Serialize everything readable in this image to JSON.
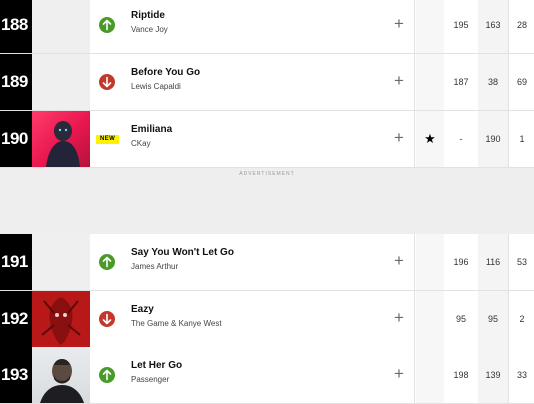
{
  "rows": [
    {
      "rank": "188",
      "title": "Riptide",
      "artist": "Vance Joy",
      "movement": "up",
      "last": "195",
      "peak": "163",
      "weeks": "28",
      "star": ""
    },
    {
      "rank": "189",
      "title": "Before You Go",
      "artist": "Lewis Capaldi",
      "movement": "down",
      "last": "187",
      "peak": "38",
      "weeks": "69",
      "star": ""
    },
    {
      "rank": "190",
      "title": "Emiliana",
      "artist": "CKay",
      "movement": "new",
      "badge": "NEW",
      "last": "-",
      "peak": "190",
      "weeks": "1",
      "star": "★"
    },
    {
      "rank": "191",
      "title": "Say You Won't Let Go",
      "artist": "James Arthur",
      "movement": "up",
      "last": "196",
      "peak": "116",
      "weeks": "53",
      "star": ""
    },
    {
      "rank": "192",
      "title": "Eazy",
      "artist": "The Game & Kanye West",
      "movement": "down",
      "last": "95",
      "peak": "95",
      "weeks": "2",
      "star": ""
    },
    {
      "rank": "193",
      "title": "Let Her Go",
      "artist": "Passenger",
      "movement": "up",
      "last": "198",
      "peak": "139",
      "weeks": "33",
      "star": ""
    }
  ],
  "ad_label": "ADVERTISEMENT",
  "colors": {
    "up": "#4a9a2a",
    "down": "#c0392b",
    "rank_bg": "#000000",
    "new_badge": "#fff200"
  },
  "icons": {
    "add": "+"
  }
}
